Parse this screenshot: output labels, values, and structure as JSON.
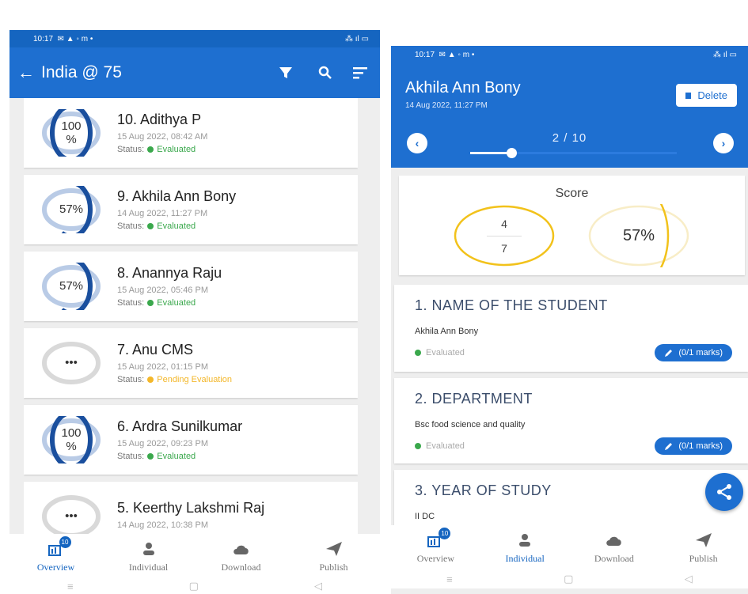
{
  "left_screen": {
    "status_bar": {
      "time": "10:17",
      "left_icons": "✉ ▲ ◦ m •",
      "right_icons": "⁂ ıl ▭"
    },
    "app_bar": {
      "title": "India @ 75",
      "back_icon": "arrow-left-icon",
      "filter_icon": "filter-icon",
      "search_icon": "search-icon",
      "sort_icon": "sort-icon"
    },
    "submissions": [
      {
        "name": "10. Adithya P",
        "date": "15 Aug 2022, 08:42 AM",
        "status_label": "Status:",
        "status": "Evaluated",
        "score_text": "100\n%",
        "score_fraction": 1.0,
        "pending": false
      },
      {
        "name": "9. Akhila Ann Bony",
        "date": "14 Aug 2022, 11:27 PM",
        "status_label": "Status:",
        "status": "Evaluated",
        "score_text": "57%",
        "score_fraction": 0.57,
        "pending": false
      },
      {
        "name": "8. Anannya Raju",
        "date": "15 Aug 2022, 05:46 PM",
        "status_label": "Status:",
        "status": "Evaluated",
        "score_text": "57%",
        "score_fraction": 0.57,
        "pending": false
      },
      {
        "name": "7. Anu CMS",
        "date": "15 Aug 2022, 01:15 PM",
        "status_label": "Status:",
        "status": "Pending Evaluation",
        "score_text": "•••",
        "score_fraction": 0,
        "pending": true
      },
      {
        "name": "6. Ardra Sunilkumar",
        "date": "15 Aug 2022, 09:23 PM",
        "status_label": "Status:",
        "status": "Evaluated",
        "score_text": "100\n%",
        "score_fraction": 1.0,
        "pending": false
      },
      {
        "name": "5. Keerthy Lakshmi Raj",
        "date": "14 Aug 2022, 10:38 PM",
        "status_label": "Status:",
        "status": "",
        "score_text": "•••",
        "score_fraction": 0,
        "pending": true
      }
    ],
    "bottom_nav": [
      {
        "label": "Overview",
        "icon": "overview-icon",
        "badge": "10",
        "active": true
      },
      {
        "label": "Individual",
        "icon": "person-icon",
        "active": false
      },
      {
        "label": "Download",
        "icon": "cloud-download-icon",
        "active": false
      },
      {
        "label": "Publish",
        "icon": "send-icon",
        "active": false
      }
    ],
    "system_nav": {
      "recent": "≡",
      "home": "▢",
      "back": "◁"
    }
  },
  "right_screen": {
    "status_bar": {
      "time": "10:17",
      "left_icons": "✉ ▲ ◦ m •",
      "right_icons": "⁂ ıl ▭"
    },
    "header": {
      "name": "Akhila Ann Bony",
      "date": "14 Aug 2022, 11:27 PM",
      "delete_label": "Delete",
      "page_indicator": "2 / 10",
      "slider_progress": 0.2,
      "prev_icon": "chevron-left-icon",
      "next_icon": "chevron-right-icon"
    },
    "score": {
      "title": "Score",
      "numerator": "4",
      "denominator": "7",
      "percent": "57%",
      "fraction": 0.57
    },
    "questions": [
      {
        "title": "1. NAME OF THE STUDENT",
        "answer": "Akhila Ann Bony",
        "status": "Evaluated",
        "marks": "(0/1 marks)"
      },
      {
        "title": "2. DEPARTMENT",
        "answer": "Bsc food science and quality",
        "status": "Evaluated",
        "marks": "(0/1 marks)"
      },
      {
        "title": "3. YEAR OF STUDY",
        "answer": "II DC",
        "status": "",
        "marks": ""
      }
    ],
    "fab_icon": "share-icon",
    "bottom_nav": [
      {
        "label": "Overview",
        "icon": "overview-icon",
        "badge": "10",
        "active": false
      },
      {
        "label": "Individual",
        "icon": "person-icon",
        "active": true
      },
      {
        "label": "Download",
        "icon": "cloud-download-icon",
        "active": false
      },
      {
        "label": "Publish",
        "icon": "send-icon",
        "active": false
      }
    ],
    "system_nav": {
      "recent": "≡",
      "home": "▢",
      "back": "◁"
    }
  },
  "colors": {
    "primary": "#1e6fd0",
    "evaluated": "#3aa84c",
    "pending": "#f3b72a",
    "score_ring": "#f2c21b"
  }
}
